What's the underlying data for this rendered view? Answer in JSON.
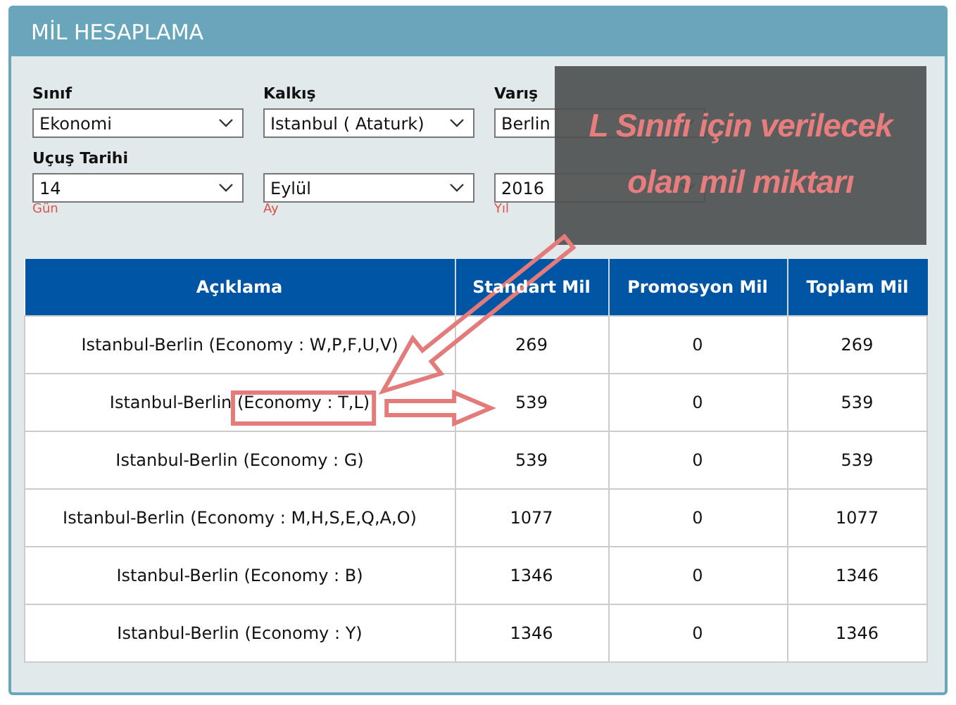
{
  "panel": {
    "title": "MİL HESAPLAMA"
  },
  "form": {
    "fields": [
      {
        "label": "Sınıf",
        "value": "Ekonomi"
      },
      {
        "label": "Kalkış",
        "value": "Istanbul ( Ataturk)"
      },
      {
        "label": "Varış",
        "value": "Berlin"
      },
      {
        "label": "Uçuş Tarihi",
        "value": "14",
        "hint": "Gün"
      },
      {
        "value": "Eylül",
        "hint": "Ay"
      },
      {
        "value": "2016",
        "hint": "Yıl"
      }
    ]
  },
  "table": {
    "columns": [
      "Açıklama",
      "Standart Mil",
      "Promosyon Mil",
      "Toplam Mil"
    ],
    "rows": [
      {
        "cells": [
          "Istanbul-Berlin (Economy : W,P,F,U,V)",
          "269",
          "0",
          "269"
        ],
        "highlighted": false
      },
      {
        "cells": [
          "Istanbul-Berlin (Economy : T,L)",
          "539",
          "0",
          "539"
        ],
        "highlighted": true
      },
      {
        "cells": [
          "Istanbul-Berlin (Economy : G)",
          "539",
          "0",
          "539"
        ],
        "highlighted": false
      },
      {
        "cells": [
          "Istanbul-Berlin (Economy : M,H,S,E,Q,A,O)",
          "1077",
          "0",
          "1077"
        ],
        "highlighted": false
      },
      {
        "cells": [
          "Istanbul-Berlin (Economy : B)",
          "1346",
          "0",
          "1346"
        ],
        "highlighted": false
      },
      {
        "cells": [
          "Istanbul-Berlin (Economy : Y)",
          "1346",
          "0",
          "1346"
        ],
        "highlighted": false
      }
    ]
  },
  "annotation": {
    "text": "L Sınıfı için verilecek olan mil miktarı"
  }
}
